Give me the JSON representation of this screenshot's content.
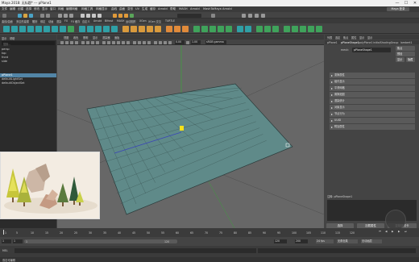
{
  "titlebar": {
    "title": "Maya 2018: 无标题* --- pPlane1",
    "minimize": "—",
    "maximize": "☐",
    "close": "✕"
  },
  "menubar": {
    "items": [
      "文件",
      "编辑",
      "创建",
      "选择",
      "修改",
      "显示",
      "窗口",
      "网格",
      "编辑网格",
      "网格工具",
      "网格显示",
      "曲线",
      "曲面",
      "变形",
      "UV",
      "生成",
      "缓存",
      "Arnold",
      "帮助",
      "MASH",
      "Arnold",
      "MashToMaya",
      "Arnold"
    ],
    "login": "Maya 登录"
  },
  "shelf": {
    "tabs": [
      "曲线/曲面",
      "多边形建模",
      "雕刻",
      "绑定",
      "动画",
      "渲染",
      "FX",
      "FX 缓存",
      "自定义",
      "Arnold",
      "Bifrost",
      "MASH",
      "运动图形",
      "XGen",
      "XGen 交互",
      "TURTLE"
    ]
  },
  "outliner": {
    "menu": [
      "显示",
      "帮助"
    ],
    "search_placeholder": "搜索...",
    "items": [
      "persp",
      "top",
      "front",
      "side",
      "pPlane1",
      "defaultLightSet",
      "defaultObjectSet"
    ],
    "selected_index": 4
  },
  "viewport": {
    "menu": [
      "视图",
      "着色",
      "照明",
      "显示",
      "渲染器",
      "面板"
    ],
    "gamma": "sRGB gamma",
    "exposure": "0.00",
    "gamma_value": "1.00"
  },
  "attribute_editor": {
    "tabs": [
      "列表",
      "选定",
      "焦点",
      "属性",
      "显示",
      "显示"
    ],
    "node_tabs": [
      "pPlane1",
      "pPlaneShape1",
      "polyPlane1",
      "initialShadingGroup",
      "lambert1"
    ],
    "mesh_label": "mesh:",
    "mesh_value": "pPlaneShape1",
    "focus_button": "焦点",
    "presets_button": "预设",
    "show_button": "显示",
    "hide_button": "隐藏",
    "sections": [
      "变换属性",
      "组件显示",
      "平滑网格",
      "置换贴图",
      "渲染统计",
      "对象显示",
      "节点行为",
      "UUID",
      "附加属性"
    ],
    "footer_label": "注释: pPlaneShape1",
    "buttons": [
      "选择",
      "加载属性",
      "复制选项卡"
    ]
  },
  "timeline": {
    "ticks": [
      "5",
      "10",
      "15",
      "20",
      "25",
      "30",
      "35",
      "40",
      "45",
      "50",
      "55",
      "60",
      "65",
      "70",
      "75",
      "80",
      "85",
      "90",
      "95",
      "100",
      "105",
      "110",
      "115",
      "120"
    ],
    "current_frame": "1"
  },
  "range": {
    "start": "1",
    "inner_start": "1",
    "inner_end": "120",
    "end": "120",
    "outer_end": "200",
    "fps": "24 fps",
    "char_set": "无角色集",
    "anim_layer": "无动画层"
  },
  "command": {
    "lang": "MEL",
    "status": "双击可编辑"
  }
}
